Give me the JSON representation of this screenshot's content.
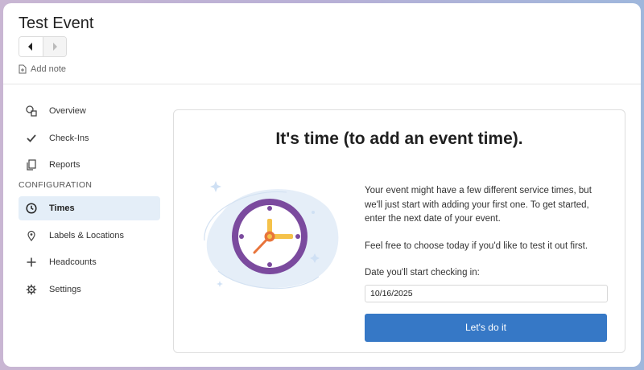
{
  "header": {
    "title": "Test Event",
    "prev_icon": "caret-left-icon",
    "next_icon": "caret-right-icon",
    "add_note_label": "Add note"
  },
  "sidebar": {
    "items_top": [
      {
        "label": "Overview",
        "icon": "overview-icon"
      },
      {
        "label": "Check-Ins",
        "icon": "check-icon"
      },
      {
        "label": "Reports",
        "icon": "reports-icon"
      }
    ],
    "section_label": "CONFIGURATION",
    "items_config": [
      {
        "label": "Times",
        "icon": "clock-icon",
        "active": true
      },
      {
        "label": "Labels & Locations",
        "icon": "location-pin-icon"
      },
      {
        "label": "Headcounts",
        "icon": "plus-icon"
      },
      {
        "label": "Settings",
        "icon": "gear-icon"
      }
    ]
  },
  "main": {
    "heading": "It's time (to add an event time).",
    "paragraph1": "Your event might have a few different service times, but we'll just start with adding your first one. To get started, enter the next date of your event.",
    "paragraph2": "Feel free to choose today if you'd like to test it out first.",
    "date_label": "Date you'll start checking in:",
    "date_value": "10/16/2025",
    "cta_label": "Let's do it"
  },
  "colors": {
    "accent": "#3678c6",
    "active_nav_bg": "#e4eef8",
    "clock_ring": "#7b4a9e",
    "clock_hands": "#f5c24a",
    "clock_minute_hand": "#e8743b"
  }
}
